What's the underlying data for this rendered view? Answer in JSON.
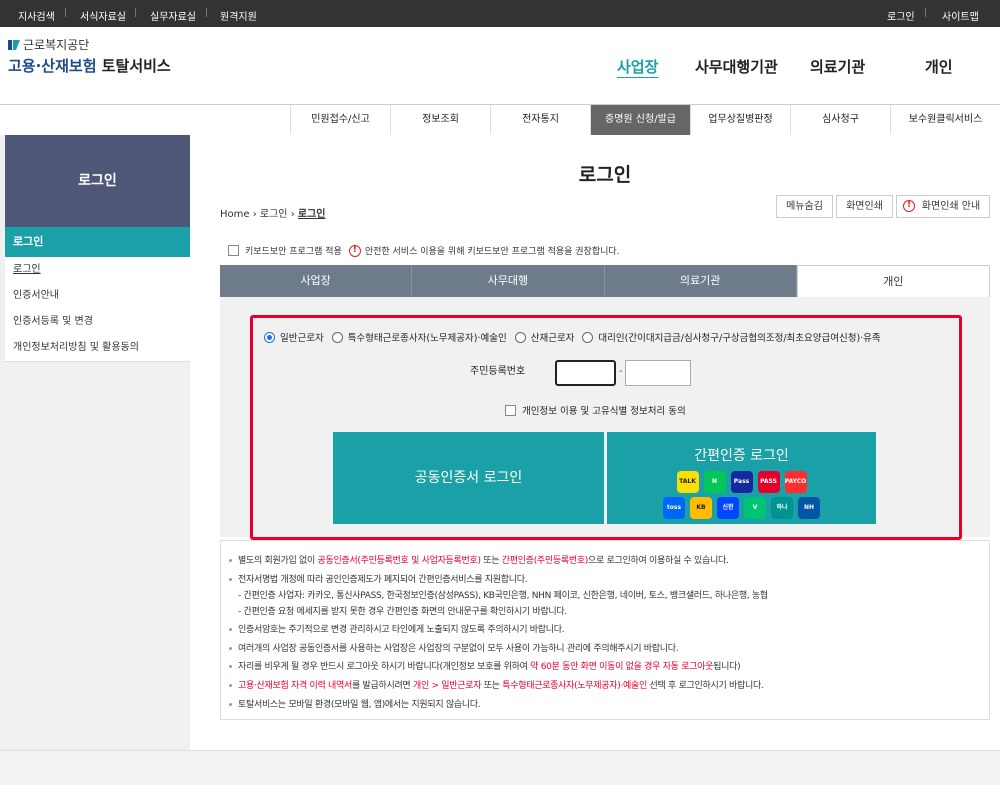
{
  "topbar": {
    "links": [
      "지사검색",
      "서식자료실",
      "실무자료실",
      "원격지원"
    ],
    "login": "로그인",
    "sitemap": "사이트맵"
  },
  "logo": {
    "agency": "근로복지공단",
    "service_a": "고용·산재보험",
    "service_b": "토탈서비스"
  },
  "gnb": [
    "사업장",
    "사무대행기관",
    "의료기관",
    "개인"
  ],
  "subnav": [
    "민원접수/신고",
    "정보조회",
    "전자통지",
    "증명원 신청/발급",
    "업무상질병판정",
    "심사청구",
    "보수원클릭서비스"
  ],
  "sidebar": {
    "title": "로그인",
    "header": "로그인",
    "items": [
      "로그인",
      "인증서안내",
      "인증서등록 및 변경",
      "개인정보처리방침 및 활용동의"
    ]
  },
  "page": {
    "title": "로그인"
  },
  "breadcrumb": {
    "home": "Home",
    "level1": "로그인",
    "level2": "로그인"
  },
  "tools": {
    "menu_hide": "메뉴숨김",
    "print": "화면인쇄",
    "print_guide": "화면인쇄 안내"
  },
  "keyboard": {
    "label": "키보드보안 프로그램 적용",
    "notice": "안전한 서비스 이용을 위해 키보드보안 프로그램 적용을 권장합니다."
  },
  "tabs": [
    "사업장",
    "사무대행",
    "의료기관",
    "개인"
  ],
  "radios": [
    "일반근로자",
    "특수형태근로종사자(노무제공자)·예술인",
    "산재근로자",
    "대리인(간이대지급금/심사청구/구상금협의조정/최초요양급여신청)·유족"
  ],
  "form": {
    "rrn_label": "주민등록번호",
    "dash": "-",
    "agree_label": "개인정보 이용 및 고유식별 정보처리 동의"
  },
  "buttons": {
    "cert_login": "공동인증서 로그인",
    "simple_login": "간편인증 로그인"
  },
  "simple_auth_icons": [
    {
      "name": "kakao-icon",
      "label": "TALK",
      "color": "#f9e000"
    },
    {
      "name": "naver-icon",
      "label": "N",
      "color": "#03c75a"
    },
    {
      "name": "samsung-pass-icon",
      "label": "Pass",
      "color": "#1428a0"
    },
    {
      "name": "pass-icon",
      "label": "PASS",
      "color": "#e4002b"
    },
    {
      "name": "payco-icon",
      "label": "PAYCO",
      "color": "#ff2e2e"
    },
    {
      "name": "toss-icon",
      "label": "toss",
      "color": "#0064ff"
    },
    {
      "name": "kb-icon",
      "label": "KB",
      "color": "#ffbc00"
    },
    {
      "name": "shinhan-icon",
      "label": "신한",
      "color": "#0046ff"
    },
    {
      "name": "banksalad-icon",
      "label": "V",
      "color": "#00c471"
    },
    {
      "name": "hana-icon",
      "label": "하나",
      "color": "#009490"
    },
    {
      "name": "nh-icon",
      "label": "NH",
      "color": "#0055a5"
    }
  ],
  "notes": {
    "n1_a": "별도의 회원가입 없이 ",
    "n1_b": "공동인증서(주민등록번호 및 사업자등록번호)",
    "n1_c": " 또는 ",
    "n1_d": "간편인증(주민등록번호)",
    "n1_e": "으로 로그인하여 이용하실 수 있습니다.",
    "n2": "전자서명법 개정에 따라 공인인증제도가 폐지되어 간편인증서비스를 지원합니다.",
    "n2_sub1": "- 간편인증 사업자: 카카오, 통신사PASS, 한국정보인증(삼성PASS), KB국민은행, NHN 페이코, 신한은행, 네이버, 토스, 뱅크샐러드, 하나은행, 농협",
    "n2_sub2": "- 간편인증 요청 메세지를 받지 못한 경우 간편인증 화면의 안내문구를 확인하시기 바랍니다.",
    "n3": "인증서암호는 주기적으로 변경 관리하시고 타인에게 노출되지 않도록 주의하시기 바랍니다.",
    "n4": "여러개의 사업장 공동인증서를 사용하는 사업장은 사업장의 구분없이 모두 사용이 가능하니 관리에 주의해주시기 바랍니다.",
    "n5_a": "자리를 비우게 될 경우 반드시 로그아웃 하시기 바랍니다(개인정보 보호를 위하여 ",
    "n5_b": "약 60분 동안 화면 이동이 없을 경우 자동 로그아웃",
    "n5_c": "됩니다)",
    "n6_a": "고용·산재보험 자격 이력 내역서",
    "n6_b": "를 발급하시려면 ",
    "n6_c": "개인 > 일반근로자",
    "n6_d": " 또는 ",
    "n6_e": "특수형태근로종사자(노무제공자)·예술인",
    "n6_f": " 선택 후 로그인하시기 바랍니다.",
    "n7": "토탈서비스는 모바일 환경(모바일 웹, 앱)에서는 지원되지 않습니다."
  },
  "colors": {
    "accent": "#1aa1a8",
    "sidebar": "#4e5777",
    "alert": "#e8002d",
    "tab": "#6e7b8b"
  }
}
